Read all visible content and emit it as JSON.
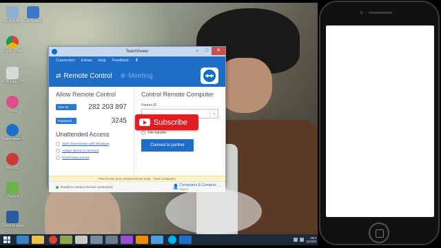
{
  "desktop": {
    "icons": [
      {
        "label": "Recycle Bin",
        "color": "#8fb0cf"
      },
      {
        "label": "Free Screen Recorder",
        "color": "#3e78c9"
      },
      {
        "label": "Google Chrome",
        "color": "#e5a032"
      },
      {
        "label": "FUN Funny Photo",
        "color": "#d8d8d8"
      },
      {
        "label": "iTunes",
        "color": "#e04b8a"
      },
      {
        "label": "TeamViewer 8",
        "color": "#1e6ec8"
      },
      {
        "label": "WinDVD",
        "color": "#c93a3a"
      },
      {
        "label": "uTorrent",
        "color": "#6ab04c"
      },
      {
        "label": "Ghost Engine",
        "color": "#2a5ba0"
      }
    ]
  },
  "taskbar": {
    "apps": [
      "explorer",
      "folder",
      "chrome",
      "app4",
      "app5",
      "app6",
      "app7",
      "premiere",
      "vlc",
      "app10",
      "skype",
      "teamviewer"
    ],
    "app_colors": [
      "#3b82c4",
      "#e8c04a",
      "#db4437",
      "#8aa64a",
      "#c8c8c8",
      "#7a8aa0",
      "#6c7c8c",
      "#9a4fd0",
      "#f08a00",
      "#4b9fe0",
      "#00aff0",
      "#1e6ec8"
    ],
    "clock_time": "18:4",
    "clock_date": "11/12/2"
  },
  "teamviewer": {
    "title": "TeamViewer",
    "menu": [
      "Connection",
      "Extras",
      "Help",
      "Feedback"
    ],
    "tabs": {
      "remote_control": "Remote Control",
      "meeting": "Meeting"
    },
    "allow": {
      "heading": "Allow Remote Control",
      "your_id_label": "Your ID",
      "your_id": "282 203 897",
      "password_label": "Password",
      "password": "3245"
    },
    "unattended": {
      "heading": "Unattended Access",
      "links": [
        "Start TeamViewer with Windows",
        "Assign device to account",
        "Grant easy access"
      ]
    },
    "control": {
      "heading": "Control Remote Computer",
      "partner_label": "Partner ID",
      "partner_value": "",
      "file_transfer": "File transfer",
      "connect_button": "Connect to partner"
    },
    "license": "Free license (non-commercial use only) - Track Computers",
    "status": "Ready to connect (secure connection)",
    "contacts": {
      "title": "Computers & Contacts",
      "sub": "Sign in"
    }
  },
  "overlay": {
    "subscribe": "Subscribe"
  }
}
